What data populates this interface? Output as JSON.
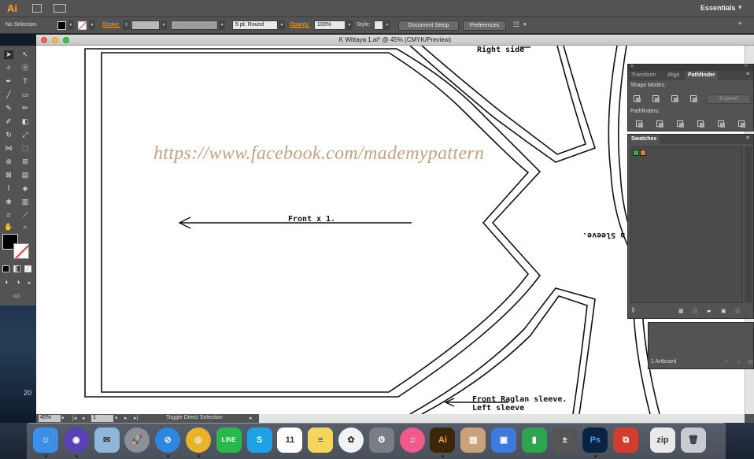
{
  "app": {
    "logo": "Ai",
    "workspace": "Essentials",
    "workspace_chevron": "‹‹"
  },
  "control_bar": {
    "selection": "No Selection",
    "stroke_label": "Stroke:",
    "brush": "5 pt. Round",
    "opacity_label": "Opacity:",
    "opacity_value": "100%",
    "style_label": "Style:",
    "document_setup": "Document Setup",
    "preferences": "Preferences"
  },
  "document": {
    "title": "K Wittaya 1.ai* @ 45% (CMYK/Preview)"
  },
  "canvas": {
    "watermark": "https://www.facebook.com/mademypattern",
    "labels": {
      "right_side": "Right side",
      "front": "Front x 1.",
      "sleeve_rotated": "n Sleeve.",
      "raglan": "Front Raglan sleeve.",
      "left_sleeve": "Left sleeve"
    }
  },
  "status": {
    "zoom": "45%",
    "artboard": "1",
    "tool_hint": "Toggle Direct Selection"
  },
  "panels": {
    "tabs": [
      "Transform",
      "Align",
      "Pathfinder"
    ],
    "active_tab": "Pathfinder",
    "shape_modes": "Shape Modes:",
    "pathfinders": "Pathfinders:",
    "expand": "Expand",
    "swatches": "Swatches",
    "artboards_count": "1 Artboard"
  },
  "desktop": {
    "year_fragment": "20"
  },
  "dock": {
    "apps": [
      {
        "name": "finder",
        "glyph": "☺",
        "color": "#3b8fe6"
      },
      {
        "name": "siri",
        "glyph": "◉",
        "color": "#5a3fb5"
      },
      {
        "name": "mail",
        "glyph": "✉",
        "color": "#8fb7d9"
      },
      {
        "name": "launchpad",
        "glyph": "🚀",
        "color": "#8a8f98"
      },
      {
        "name": "safari",
        "glyph": "⊘",
        "color": "#2f86e0"
      },
      {
        "name": "chrome",
        "glyph": "◎",
        "color": "#e8b32a"
      },
      {
        "name": "line",
        "glyph": "LINE",
        "color": "#29b84c"
      },
      {
        "name": "skype",
        "glyph": "S",
        "color": "#1ea1e6"
      },
      {
        "name": "calendar",
        "glyph": "11",
        "color": "#ffffff",
        "sub": "FEB"
      },
      {
        "name": "notes",
        "glyph": "≡",
        "color": "#f5d65a"
      },
      {
        "name": "photos",
        "glyph": "✿",
        "color": "#f2f2f2"
      },
      {
        "name": "system-preferences",
        "glyph": "⚙",
        "color": "#7a7d84"
      },
      {
        "name": "itunes",
        "glyph": "♫",
        "color": "#f05a8c"
      },
      {
        "name": "illustrator",
        "glyph": "Ai",
        "color": "#3a2608"
      },
      {
        "name": "preview",
        "glyph": "▤",
        "color": "#c9a27a"
      },
      {
        "name": "keynote",
        "glyph": "▣",
        "color": "#3d7ae0"
      },
      {
        "name": "numbers",
        "glyph": "▮",
        "color": "#2ea44f"
      },
      {
        "name": "calculator",
        "glyph": "±",
        "color": "#555"
      },
      {
        "name": "photoshop",
        "glyph": "Ps",
        "color": "#0b2240"
      },
      {
        "name": "remote-desktop",
        "glyph": "⧉",
        "color": "#d33d2e"
      },
      {
        "name": "archive",
        "glyph": "zip",
        "color": "#e9e9e9"
      },
      {
        "name": "trash",
        "glyph": "🗑",
        "color": "#c8ccd2"
      }
    ]
  }
}
